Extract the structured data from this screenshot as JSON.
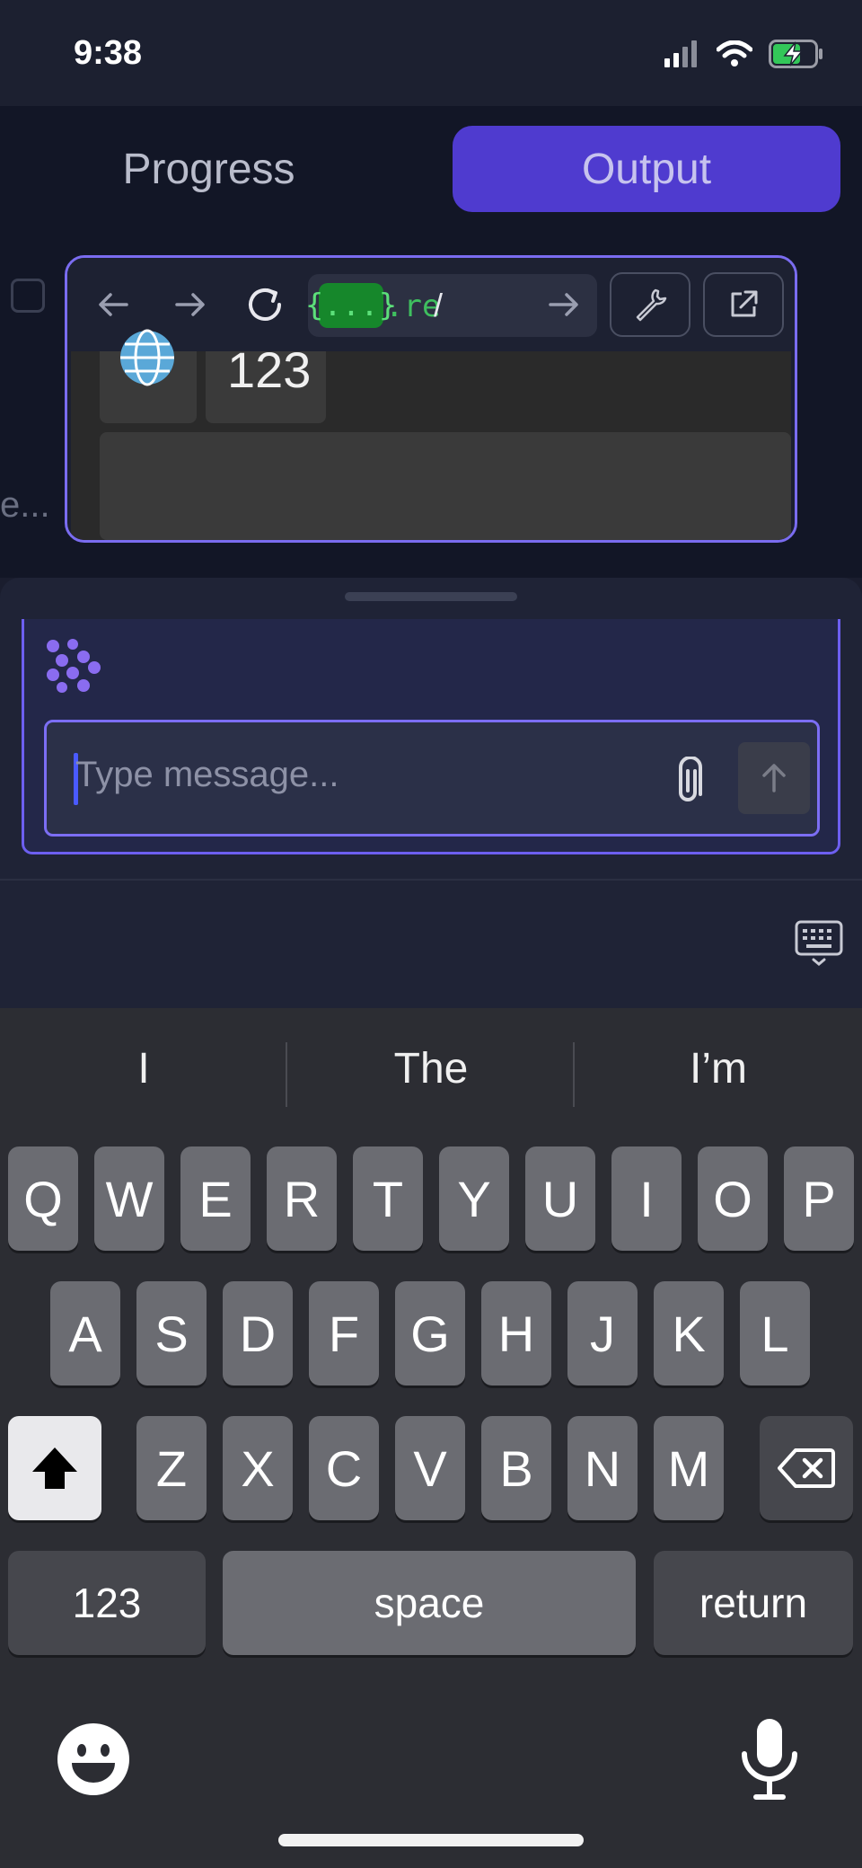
{
  "status_bar": {
    "time": "9:38",
    "icons": [
      "cellular-signal-icon",
      "wifi-icon",
      "battery-charging-icon"
    ]
  },
  "tabs": {
    "progress_label": "Progress",
    "output_label": "Output",
    "active": "Output"
  },
  "sidebar_peek": {
    "ellipsis": "e..."
  },
  "browser": {
    "url_badge": "{...}",
    "url_suffix": ".re",
    "url_path": "/",
    "preview_number": "123"
  },
  "chat": {
    "input_placeholder": "Type message...",
    "input_value": ""
  },
  "keyboard": {
    "suggestions": [
      "I",
      "The",
      "I’m"
    ],
    "row1": [
      "Q",
      "W",
      "E",
      "R",
      "T",
      "Y",
      "U",
      "I",
      "O",
      "P"
    ],
    "row2": [
      "A",
      "S",
      "D",
      "F",
      "G",
      "H",
      "J",
      "K",
      "L"
    ],
    "row3": [
      "Z",
      "X",
      "C",
      "V",
      "B",
      "N",
      "M"
    ],
    "numbers_label": "123",
    "space_label": "space",
    "return_label": "return"
  },
  "colors": {
    "accent": "#4f3bcf",
    "border_accent": "#7a6cf0",
    "url_badge_bg": "#16872b"
  }
}
